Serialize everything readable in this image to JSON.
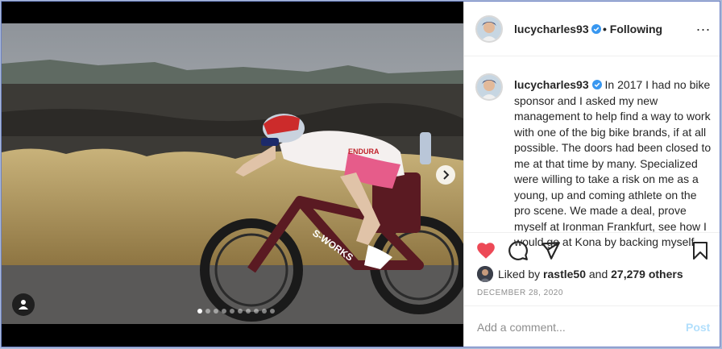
{
  "post": {
    "username": "lucycharles93",
    "follow_status": "• Following",
    "more_label": "...",
    "caption_username": "lucycharles93",
    "caption_text": "In 2017 I had no bike sponsor and I asked my new management to help find a way to work with one of the big bike brands, if at all possible. The doors had been closed to me at that time by many. Specialized were willing to take a risk on me as a young, up and coming athlete on the pro scene. We made a deal, prove myself at Ironman Frankfurt, see how I would go at Kona by backing myself",
    "liked_by_prefix": "Liked by ",
    "liked_by_user": "rastle50",
    "liked_by_middle": " and ",
    "liked_by_others": "27,279 others",
    "date": "DECEMBER 28, 2020",
    "comment_placeholder": "Add a comment...",
    "post_button": "Post"
  },
  "carousel": {
    "total_slides": 10,
    "active_slide": 1
  },
  "photo_text": {
    "bike_brand": "S-WORKS",
    "jersey_brand": "ENDURA"
  },
  "icons": {
    "verified": "verified-badge-icon",
    "like": "heart-filled-icon",
    "comment": "comment-bubble-icon",
    "share": "paper-plane-icon",
    "save": "bookmark-icon",
    "next": "chevron-right-icon",
    "tags": "user-tag-icon"
  },
  "colors": {
    "like_red": "#ed4956",
    "verified_blue": "#3897f0",
    "post_disabled_blue": "#b2dffc",
    "text_dark": "#262626",
    "text_muted": "#8e8e8e"
  }
}
